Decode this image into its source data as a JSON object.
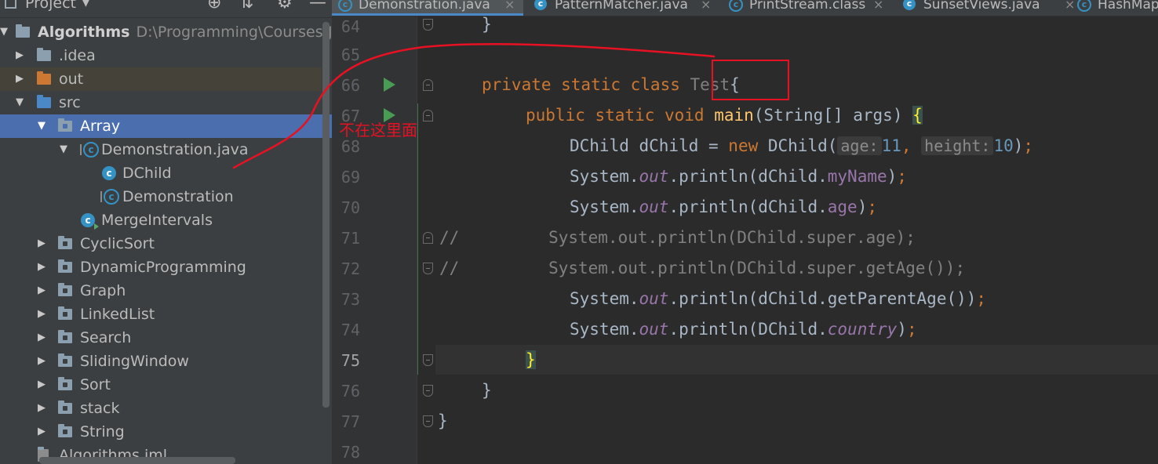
{
  "project_panel": {
    "title": "Project",
    "dropdown_icon": "caret-down-icon",
    "header_icons": [
      "crosshair-icon",
      "collapse-all-icon",
      "gear-icon",
      "minimize-icon"
    ],
    "tree": [
      {
        "label": "Algorithms",
        "path": "D:\\Programming\\Courses\\JAVA",
        "icon": "module-folder-icon",
        "expanded": true
      },
      {
        "label": ".idea",
        "icon": "folder-icon",
        "expanded": false
      },
      {
        "label": "out",
        "icon": "excluded-folder-icon",
        "expanded": false
      },
      {
        "label": "src",
        "icon": "source-folder-icon",
        "expanded": true
      },
      {
        "label": "Array",
        "icon": "package-icon",
        "expanded": true,
        "selected": true
      },
      {
        "label": "Demonstration.java",
        "icon": "java-file-icon",
        "expanded": true
      },
      {
        "label": "DChild",
        "icon": "class-icon"
      },
      {
        "label": "Demonstration",
        "icon": "class-icon"
      },
      {
        "label": "MergeIntervals",
        "icon": "runnable-class-icon"
      },
      {
        "label": "CyclicSort",
        "icon": "package-icon",
        "expanded": false
      },
      {
        "label": "DynamicProgramming",
        "icon": "package-icon",
        "expanded": false
      },
      {
        "label": "Graph",
        "icon": "package-icon",
        "expanded": false
      },
      {
        "label": "LinkedList",
        "icon": "package-icon",
        "expanded": false
      },
      {
        "label": "Search",
        "icon": "package-icon",
        "expanded": false
      },
      {
        "label": "SlidingWindow",
        "icon": "package-icon",
        "expanded": false
      },
      {
        "label": "Sort",
        "icon": "package-icon",
        "expanded": false
      },
      {
        "label": "stack",
        "icon": "package-icon",
        "expanded": false
      },
      {
        "label": "String",
        "icon": "package-icon",
        "expanded": false
      },
      {
        "label": "Algorithms.iml",
        "icon": "iml-file-icon"
      }
    ]
  },
  "tabs": [
    {
      "label": "Demonstration.java",
      "active": true
    },
    {
      "label": "PatternMatcher.java"
    },
    {
      "label": "PrintStream.class"
    },
    {
      "label": "SunsetViews.java"
    },
    {
      "label": "HashMap"
    }
  ],
  "editor": {
    "current_line": 75,
    "lines": [
      {
        "n": "64"
      },
      {
        "n": "65"
      },
      {
        "n": "66"
      },
      {
        "n": "67"
      },
      {
        "n": "68"
      },
      {
        "n": "69"
      },
      {
        "n": "70"
      },
      {
        "n": "71"
      },
      {
        "n": "72"
      },
      {
        "n": "73"
      },
      {
        "n": "74"
      },
      {
        "n": "75"
      },
      {
        "n": "76"
      },
      {
        "n": "77"
      },
      {
        "n": "78"
      }
    ],
    "code": {
      "l64_brace": "}",
      "l66_kw": "private static class",
      "l66_name": "Test",
      "l66_brace": "{",
      "l67_kw": "public static void",
      "l67_method": "main",
      "l67_params": "(String[] args)",
      "l67_brace": "{",
      "l68_a": "DChild dChild = ",
      "l68_new": "new",
      "l68_b": " DChild(",
      "l68_hint1": "age:",
      "l68_num1": "11",
      "l68_comma": ", ",
      "l68_hint2": "height:",
      "l68_num2": "10",
      "l68_c": ")",
      "semicolon": ";",
      "system": "System.",
      "out": "out",
      "println_open": ".println(",
      "l69_obj": "dChild.",
      "l69_field": "myName",
      "l70_obj": "dChild.",
      "l70_field": "age",
      "close_paren": ")",
      "l71_comment": "//         System.out.println(DChild.super.age);",
      "l72_comment": "//         System.out.println(DChild.super.getAge());",
      "l73_call": "dChild.getParentAge())",
      "l74_obj": "DChild.",
      "l74_field": "country",
      "close_brace": "}"
    }
  },
  "annotation": {
    "text": "不在这里面",
    "color": "#e81123"
  },
  "colors": {
    "keyword": "#cc7832",
    "method": "#ffc66d",
    "field": "#9876aa",
    "number": "#6897bb",
    "selection": "#4b6eaf"
  }
}
